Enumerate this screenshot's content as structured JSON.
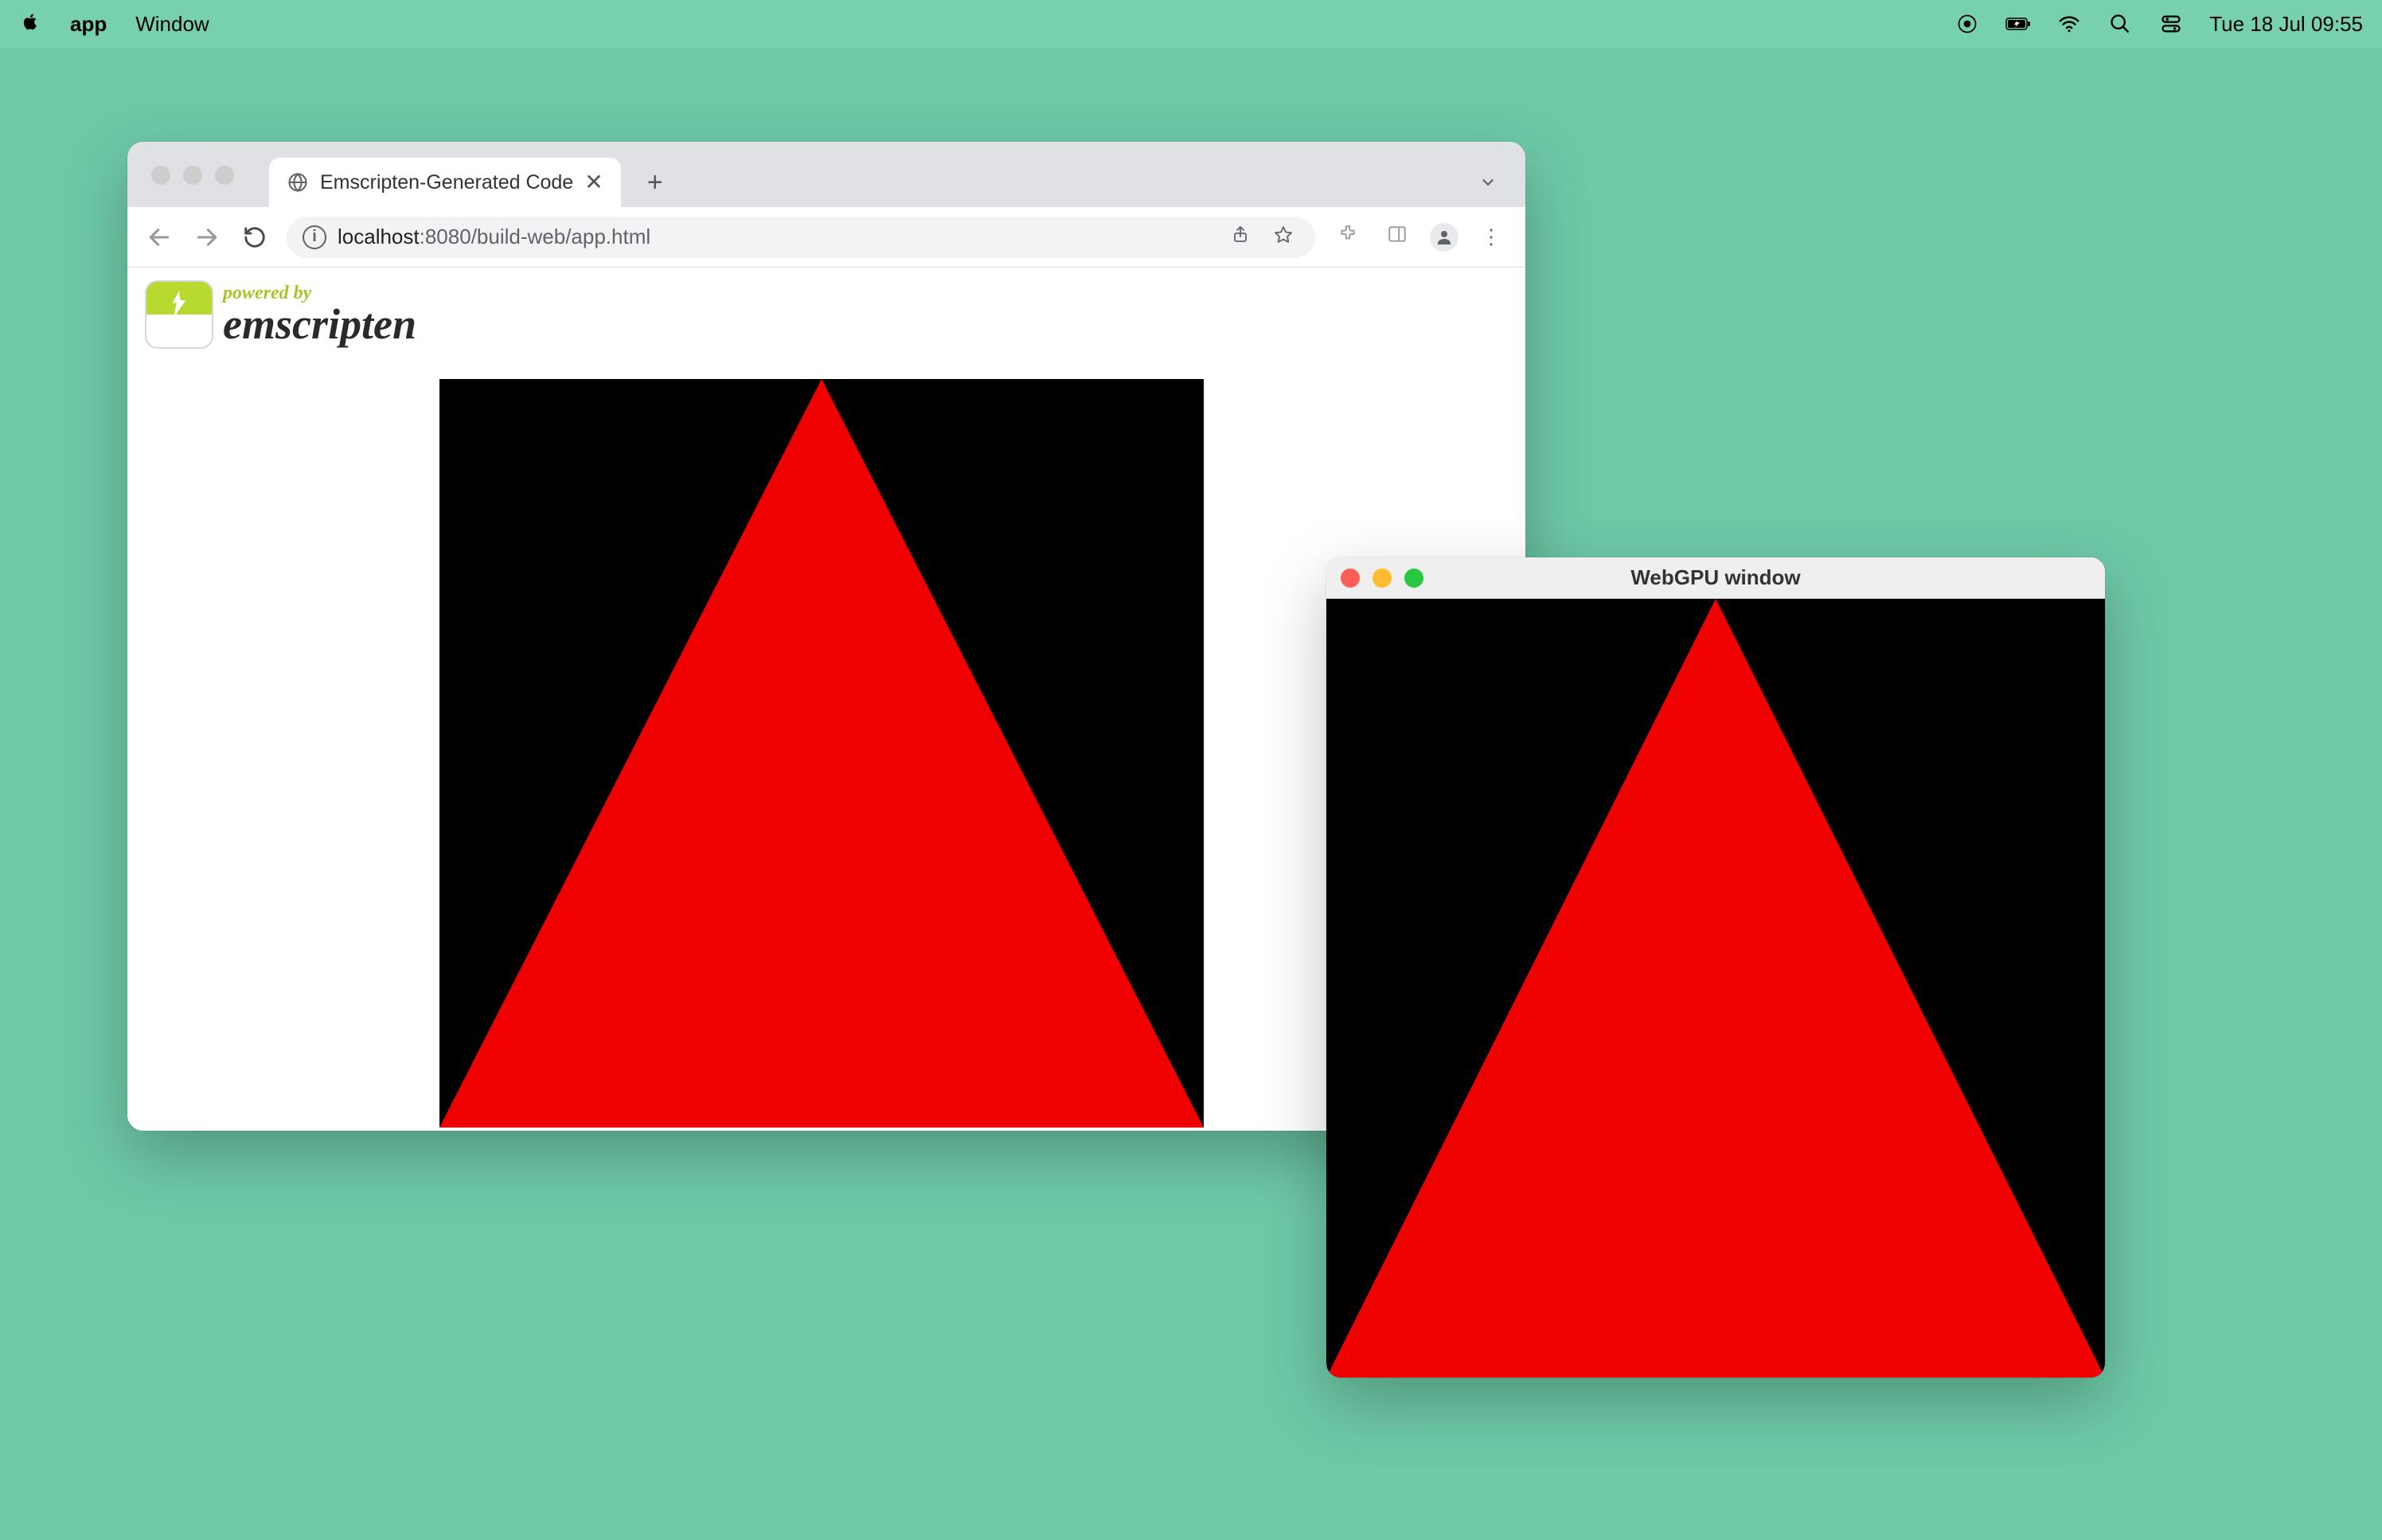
{
  "menubar": {
    "app_name": "app",
    "menu_window": "Window",
    "clock": "Tue 18 Jul  09:55"
  },
  "browser": {
    "tab_title": "Emscripten-Generated Code",
    "url_host": "localhost",
    "url_rest": ":8080/build-web/app.html",
    "badge_powered_by": "powered by",
    "badge_name": "emscripten"
  },
  "native": {
    "title": "WebGPU window"
  },
  "colors": {
    "desktop_bg": "#6ec9a7",
    "triangle_fill": "#f00000",
    "canvas_bg": "#000000"
  }
}
